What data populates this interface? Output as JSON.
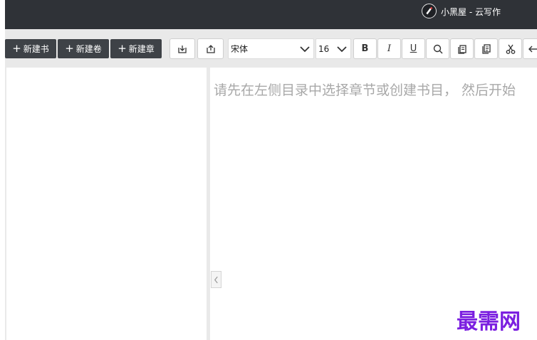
{
  "titlebar": {
    "title": "小黑屋 - 云写作",
    "logo_icon": "pen-nib-icon"
  },
  "toolbar": {
    "new_book_label": "新建书",
    "new_volume_label": "新建卷",
    "new_chapter_label": "新建章",
    "font_family": "宋体",
    "font_size": "16",
    "bold_label": "B",
    "italic_label": "I",
    "underline_label": "U"
  },
  "editor": {
    "placeholder": "请先在左侧目录中选择章节或创建书目，  然后开始"
  },
  "watermark": {
    "text": "最需网"
  },
  "colors": {
    "titlebar_bg": "#2f3237",
    "button_bg": "#3e4247",
    "watermark": "#7b1fe0"
  }
}
